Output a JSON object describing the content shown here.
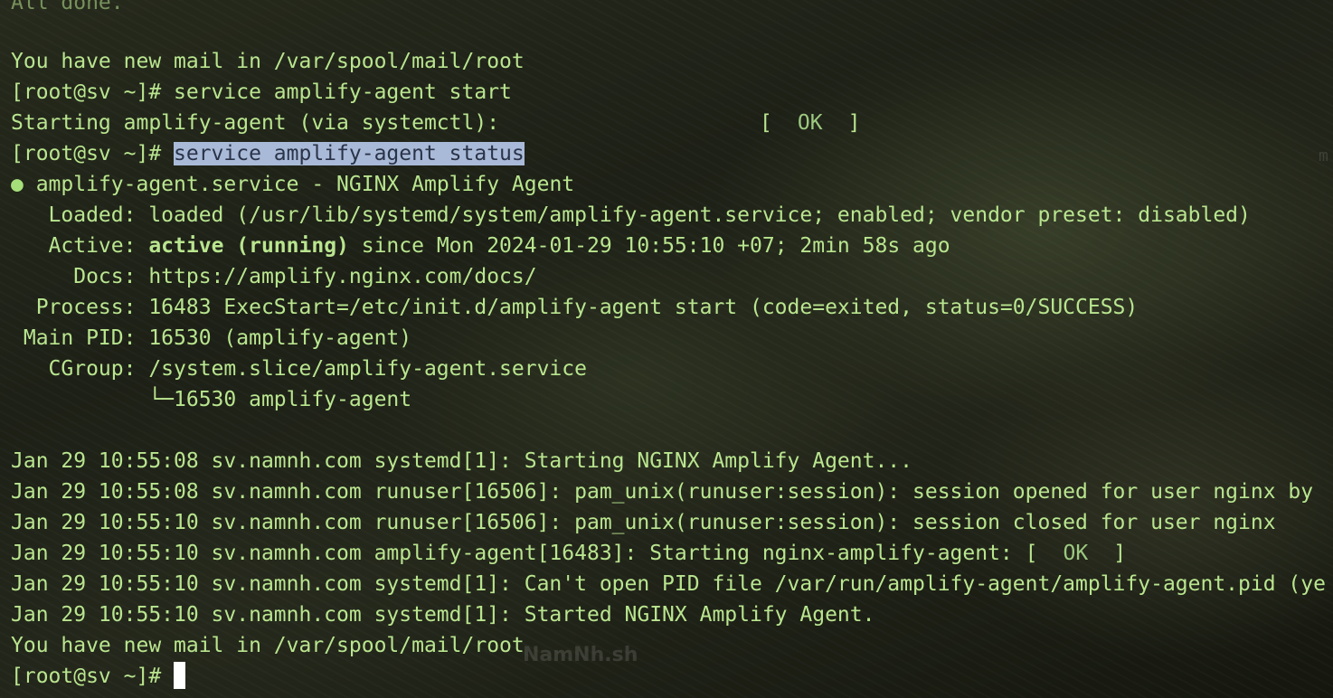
{
  "lines": {
    "l0": "All done.",
    "l1": "You have new mail in /var/spool/mail/root",
    "l2_prompt": "[root@sv ~]# ",
    "l2_cmd": "service amplify-agent start",
    "l3_text": "Starting amplify-agent (via systemctl):",
    "l3_open": "[",
    "l3_ok": "OK",
    "l3_close": "]",
    "l4_prompt": "[root@sv ~]# ",
    "l4_cmd": "service amplify-agent status",
    "l5_dot": "●",
    "l5_text": " amplify-agent.service - NGINX Amplify Agent",
    "l6": "   Loaded: loaded (/usr/lib/systemd/system/amplify-agent.service; enabled; vendor preset: disabled)",
    "l7_label": "   Active: ",
    "l7_state": "active (running)",
    "l7_rest": " since Mon 2024-01-29 10:55:10 +07; 2min 58s ago",
    "l8": "     Docs: https://amplify.nginx.com/docs/",
    "l9": "  Process: 16483 ExecStart=/etc/init.d/amplify-agent start (code=exited, status=0/SUCCESS)",
    "l10": " Main PID: 16530 (amplify-agent)",
    "l11": "   CGroup: /system.slice/amplify-agent.service",
    "l12": "           └─16530 amplify-agent",
    "l13": "Jan 29 10:55:08 sv.namnh.com systemd[1]: Starting NGINX Amplify Agent...",
    "l14": "Jan 29 10:55:08 sv.namnh.com runuser[16506]: pam_unix(runuser:session): session opened for user nginx by",
    "l15": "Jan 29 10:55:10 sv.namnh.com runuser[16506]: pam_unix(runuser:session): session closed for user nginx",
    "l16_text": "Jan 29 10:55:10 sv.namnh.com amplify-agent[16483]: Starting nginx-amplify-agent: ",
    "l16_open": "[",
    "l16_ok": "OK",
    "l16_close": "]",
    "l17": "Jan 29 10:55:10 sv.namnh.com systemd[1]: Can't open PID file /var/run/amplify-agent/amplify-agent.pid (ye",
    "l18": "Jan 29 10:55:10 sv.namnh.com systemd[1]: Started NGINX Amplify Agent.",
    "l19": "You have new mail in /var/spool/mail/root",
    "l20_prompt": "[root@sv ~]# "
  },
  "watermark": "NamNh.sh",
  "edge_mark": "m",
  "colors": {
    "text": "#b9e58f",
    "highlight_bg": "#a9bad8",
    "cursor": "#ffffff"
  }
}
